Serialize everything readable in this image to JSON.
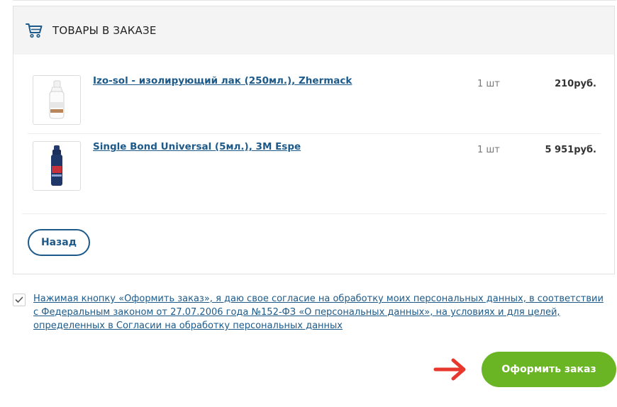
{
  "cart": {
    "title": "ТОВАРЫ В ЗАКАЗЕ",
    "items": [
      {
        "name": "Izo-sol - изолирующий лак (250мл.), Zhermack",
        "qty": "1 шт",
        "price": "210руб.",
        "thumb_icon": "white-bottle-icon"
      },
      {
        "name": "Single Bond Universal (5мл.), 3M Espe",
        "qty": "1 шт",
        "price": "5 951руб.",
        "thumb_icon": "dark-blue-bottle-icon"
      }
    ]
  },
  "buttons": {
    "back_label": "Назад",
    "order_label": "Оформить заказ"
  },
  "consent": {
    "checked": true,
    "text": "Нажимая кнопку «Оформить заказ», я даю свое согласие на обработку моих персональных данных, в соответствии с Федеральным законом от 27.07.2006 года №152-ФЗ «О персональных данных», на условиях и для целей, определенных в Согласии на обработку персональных данных"
  },
  "colors": {
    "link": "#1d5a8a",
    "order_button": "#6ab523",
    "arrow": "#e8372c"
  }
}
